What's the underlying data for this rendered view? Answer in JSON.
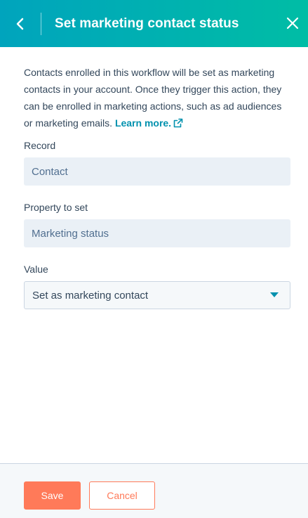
{
  "header": {
    "title": "Set marketing contact status",
    "back_icon": "chevron-left-icon",
    "close_icon": "close-icon"
  },
  "description": {
    "text": "Contacts enrolled in this workflow will be set as marketing contacts in your account. Once they trigger this action, they can be enrolled in marketing actions, such as ad audiences or marketing emails. ",
    "link_label": "Learn more.",
    "link_icon": "external-link-icon"
  },
  "fields": {
    "record": {
      "label": "Record",
      "value": "Contact"
    },
    "property": {
      "label": "Property to set",
      "value": "Marketing status"
    },
    "value": {
      "label": "Value",
      "selected": "Set as marketing contact",
      "icon": "caret-down-icon"
    }
  },
  "footer": {
    "save_label": "Save",
    "cancel_label": "Cancel"
  },
  "colors": {
    "header_gradient_start": "#00a4bd",
    "header_gradient_end": "#00bda5",
    "link": "#0091ae",
    "primary_button": "#ff7a59",
    "text": "#33475b"
  }
}
